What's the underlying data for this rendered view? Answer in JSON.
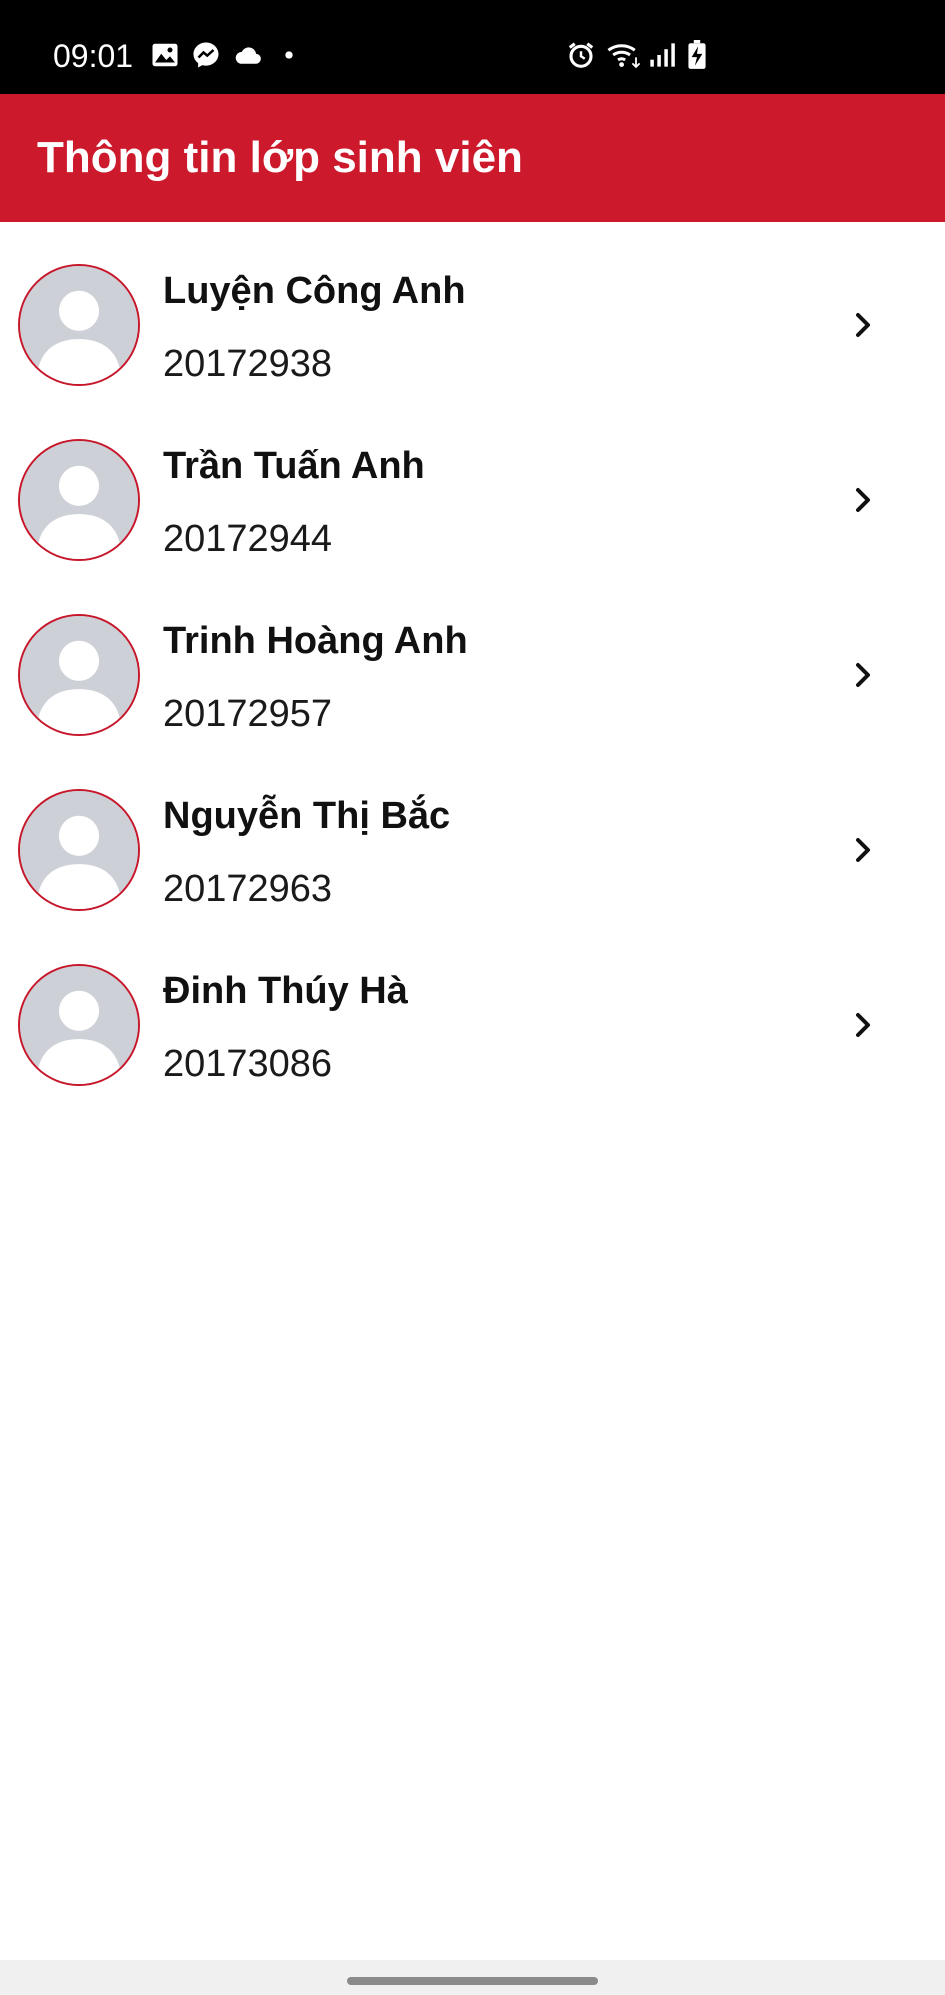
{
  "status_bar": {
    "time": "09:01",
    "left_icons": [
      "gallery-icon",
      "messenger-icon",
      "cloud-icon",
      "dot-icon"
    ],
    "right_icons": [
      "alarm-icon",
      "wifi-icon",
      "signal-icon",
      "battery-charging-icon"
    ]
  },
  "header": {
    "title": "Thông tin lớp sinh viên",
    "background_color": "#cc1a2c"
  },
  "students": [
    {
      "name": "Luyện Công Anh",
      "id": "20172938"
    },
    {
      "name": "Trần Tuấn Anh",
      "id": "20172944"
    },
    {
      "name": "Trinh Hoàng Anh",
      "id": "20172957"
    },
    {
      "name": "Nguyễn Thị Bắc",
      "id": "20172963"
    },
    {
      "name": "Đinh Thúy Hà",
      "id": "20173086"
    }
  ],
  "accent_color": "#c8172b"
}
